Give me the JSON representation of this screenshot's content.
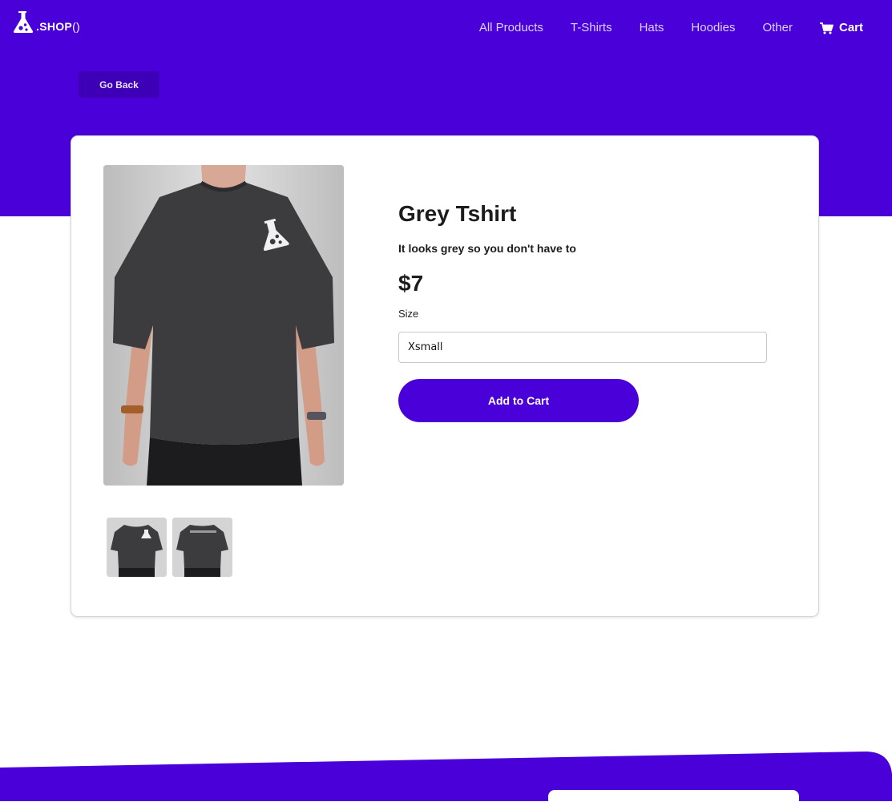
{
  "brand": {
    "name": ".SHOP",
    "suffix": "()"
  },
  "nav": {
    "links": [
      "All Products",
      "T-Shirts",
      "Hats",
      "Hoodies",
      "Other"
    ],
    "cart_label": "Cart"
  },
  "go_back_label": "Go Back",
  "product": {
    "title": "Grey Tshirt",
    "description": "It looks grey so you don't have to",
    "price": "$7",
    "size_label": "Size",
    "size_selected": "Xsmall",
    "add_to_cart_label": "Add to Cart"
  },
  "colors": {
    "brand": "#4a00d8",
    "shirt": "#3c3c3e"
  },
  "icons": {
    "logo": "flask-logo-icon",
    "cart": "cart-icon"
  }
}
